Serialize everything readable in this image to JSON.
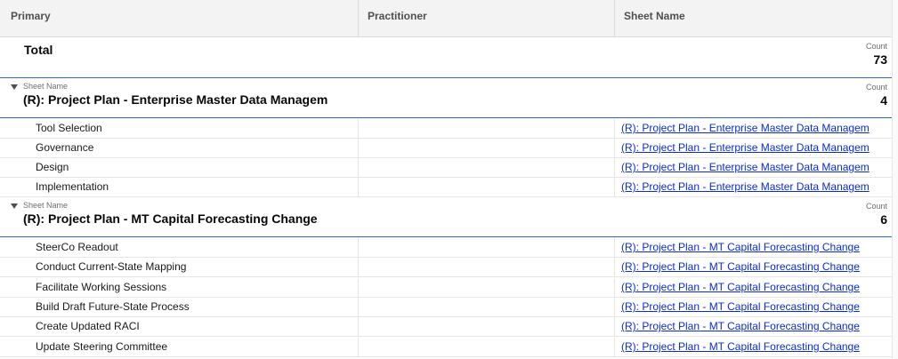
{
  "columns": {
    "primary": "Primary",
    "practitioner": "Practitioner",
    "sheet_name": "Sheet Name"
  },
  "total": {
    "label": "Total",
    "count_label": "Count",
    "count": "73"
  },
  "groups": [
    {
      "field_label": "Sheet Name",
      "name": "(R): Project Plan - Enterprise Master Data Managem",
      "count_label": "Count",
      "count": "4",
      "rows": [
        {
          "primary": "Tool Selection",
          "practitioner": "",
          "sheet": "(R): Project Plan - Enterprise Master Data Managem"
        },
        {
          "primary": "Governance",
          "practitioner": "",
          "sheet": "(R): Project Plan - Enterprise Master Data Managem"
        },
        {
          "primary": "Design",
          "practitioner": "",
          "sheet": "(R): Project Plan - Enterprise Master Data Managem"
        },
        {
          "primary": "Implementation",
          "practitioner": "",
          "sheet": "(R): Project Plan - Enterprise Master Data Managem"
        }
      ]
    },
    {
      "field_label": "Sheet Name",
      "name": "(R): Project Plan - MT Capital Forecasting Change",
      "count_label": "Count",
      "count": "6",
      "rows": [
        {
          "primary": "SteerCo Readout",
          "practitioner": "",
          "sheet": "(R): Project Plan - MT Capital Forecasting Change"
        },
        {
          "primary": "Conduct Current-State Mapping",
          "practitioner": "",
          "sheet": "(R): Project Plan - MT Capital Forecasting Change"
        },
        {
          "primary": "Facilitate Working Sessions",
          "practitioner": "",
          "sheet": "(R): Project Plan - MT Capital Forecasting Change"
        },
        {
          "primary": "Build Draft Future-State Process",
          "practitioner": "",
          "sheet": "(R): Project Plan - MT Capital Forecasting Change"
        },
        {
          "primary": "Create Updated RACI",
          "practitioner": "",
          "sheet": "(R): Project Plan - MT Capital Forecasting Change"
        },
        {
          "primary": "Update Steering Committee",
          "practitioner": "",
          "sheet": "(R): Project Plan - MT Capital Forecasting Change"
        }
      ]
    }
  ],
  "colors": {
    "accent_line": "#2e6ac2",
    "link": "#0a2bd8",
    "header_bg": "#f3f3f3"
  },
  "icons": {
    "group_toggle": "triangle-down-icon"
  }
}
